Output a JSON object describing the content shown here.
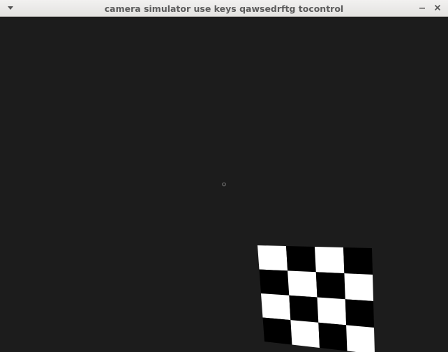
{
  "window": {
    "title": "camera simulator use keys qawsedrftg tocontrol"
  },
  "icons": {
    "menu": "triangle-down-icon",
    "minimize": "minimize-icon",
    "close": "close-icon"
  },
  "scene": {
    "background": "#1c1c1c",
    "board": {
      "rows": 4,
      "cols": 4,
      "light_color": "#ffffff",
      "dark_color": "#000000"
    },
    "marker": {
      "shape": "small-circle",
      "color": "#777777"
    }
  }
}
